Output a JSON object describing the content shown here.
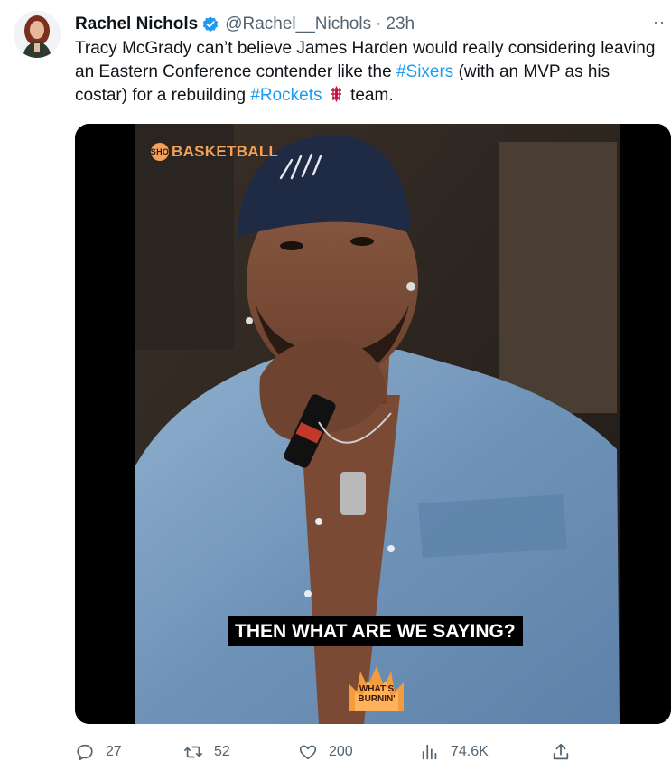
{
  "tweet": {
    "author_name": "Rachel Nichols",
    "handle": "@Rachel__Nichols",
    "separator": "·",
    "time": "23h",
    "more": "··",
    "text_1": "Tracy McGrady can’t believe James Harden would really considering leaving an Eastern Conference contender like the ",
    "hashtag_1": "#Sixers",
    "text_2": " (with an MVP as his costar) for a rebuilding ",
    "hashtag_2": "#Rockets",
    "text_3": " team."
  },
  "media": {
    "brand_badge": "SHO",
    "brand": "BASKETBALL",
    "caption": "THEN WHAT ARE WE SAYING?",
    "logo_line1": "WHAT'S",
    "logo_line2": "BURNIN'"
  },
  "actions": {
    "replies": "27",
    "retweets": "52",
    "likes": "200",
    "views": "74.6K"
  },
  "colors": {
    "link": "#1d9bf0",
    "verified": "#1d9bf0",
    "muted": "#536471",
    "brand_orange": "#f2a05a"
  },
  "icons": [
    "verified-badge-icon",
    "more-icon",
    "rockets-emoji-icon",
    "reply-icon",
    "retweet-icon",
    "like-icon",
    "views-icon",
    "share-icon"
  ]
}
